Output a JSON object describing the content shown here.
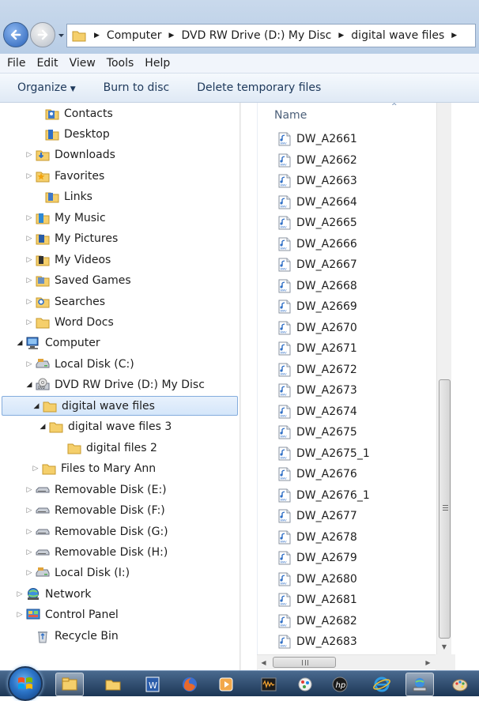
{
  "address_bar": {
    "breadcrumbs": [
      "Computer",
      "DVD RW Drive (D:) My Disc",
      "digital wave files"
    ]
  },
  "menubar": {
    "items": [
      "File",
      "Edit",
      "View",
      "Tools",
      "Help"
    ]
  },
  "commandbar": {
    "organize": "Organize",
    "burn": "Burn to disc",
    "delete_temp": "Delete temporary files"
  },
  "navtree": {
    "items": [
      {
        "label": "Contacts",
        "icon": "contacts-folder-icon"
      },
      {
        "label": "Desktop",
        "icon": "desktop-folder-icon"
      },
      {
        "label": "Downloads",
        "icon": "downloads-folder-icon"
      },
      {
        "label": "Favorites",
        "icon": "favorites-folder-icon"
      },
      {
        "label": "Links",
        "icon": "links-folder-icon"
      },
      {
        "label": "My Music",
        "icon": "music-folder-icon"
      },
      {
        "label": "My Pictures",
        "icon": "pictures-folder-icon"
      },
      {
        "label": "My Videos",
        "icon": "videos-folder-icon"
      },
      {
        "label": "Saved Games",
        "icon": "games-folder-icon"
      },
      {
        "label": "Searches",
        "icon": "searches-folder-icon"
      },
      {
        "label": "Word Docs",
        "icon": "folder-icon"
      },
      {
        "label": "Computer",
        "icon": "computer-icon"
      },
      {
        "label": "Local Disk (C:)",
        "icon": "hard-disk-icon"
      },
      {
        "label": "DVD RW Drive (D:) My Disc",
        "icon": "dvd-drive-icon"
      },
      {
        "label": "digital wave files",
        "icon": "folder-icon"
      },
      {
        "label": "digital wave files 3",
        "icon": "folder-icon"
      },
      {
        "label": "digital files 2",
        "icon": "folder-icon"
      },
      {
        "label": "Files to Mary Ann",
        "icon": "folder-icon"
      },
      {
        "label": "Removable Disk (E:)",
        "icon": "removable-disk-icon"
      },
      {
        "label": "Removable Disk (F:)",
        "icon": "removable-disk-icon"
      },
      {
        "label": "Removable Disk (G:)",
        "icon": "removable-disk-icon"
      },
      {
        "label": "Removable Disk (H:)",
        "icon": "removable-disk-icon"
      },
      {
        "label": "Local Disk (I:)",
        "icon": "hard-disk-icon"
      },
      {
        "label": "Network",
        "icon": "network-icon"
      },
      {
        "label": "Control Panel",
        "icon": "control-panel-icon"
      },
      {
        "label": "Recycle Bin",
        "icon": "recycle-bin-icon"
      }
    ],
    "selected": "digital wave files"
  },
  "filelist": {
    "column_name": "Name",
    "files": [
      "DW_A2661",
      "DW_A2662",
      "DW_A2663",
      "DW_A2664",
      "DW_A2665",
      "DW_A2666",
      "DW_A2667",
      "DW_A2668",
      "DW_A2669",
      "DW_A2670",
      "DW_A2671",
      "DW_A2672",
      "DW_A2673",
      "DW_A2674",
      "DW_A2675",
      "DW_A2675_1",
      "DW_A2676",
      "DW_A2676_1",
      "DW_A2677",
      "DW_A2678",
      "DW_A2679",
      "DW_A2680",
      "DW_A2681",
      "DW_A2682",
      "DW_A2683"
    ],
    "file_icon": "wav-file-icon"
  },
  "taskbar": {
    "icons": [
      "start-orb-icon",
      "file-explorer-icon",
      "folder-icon",
      "word-icon",
      "firefox-icon",
      "media-player-icon",
      "audacity-icon",
      "paint-icon",
      "hp-icon",
      "internet-explorer-icon",
      "network-drive-icon",
      "paint-palette-icon"
    ]
  },
  "colors": {
    "selection_border": "#84acdd",
    "command_text": "#1e395b",
    "taskbar": "#1c3655"
  }
}
